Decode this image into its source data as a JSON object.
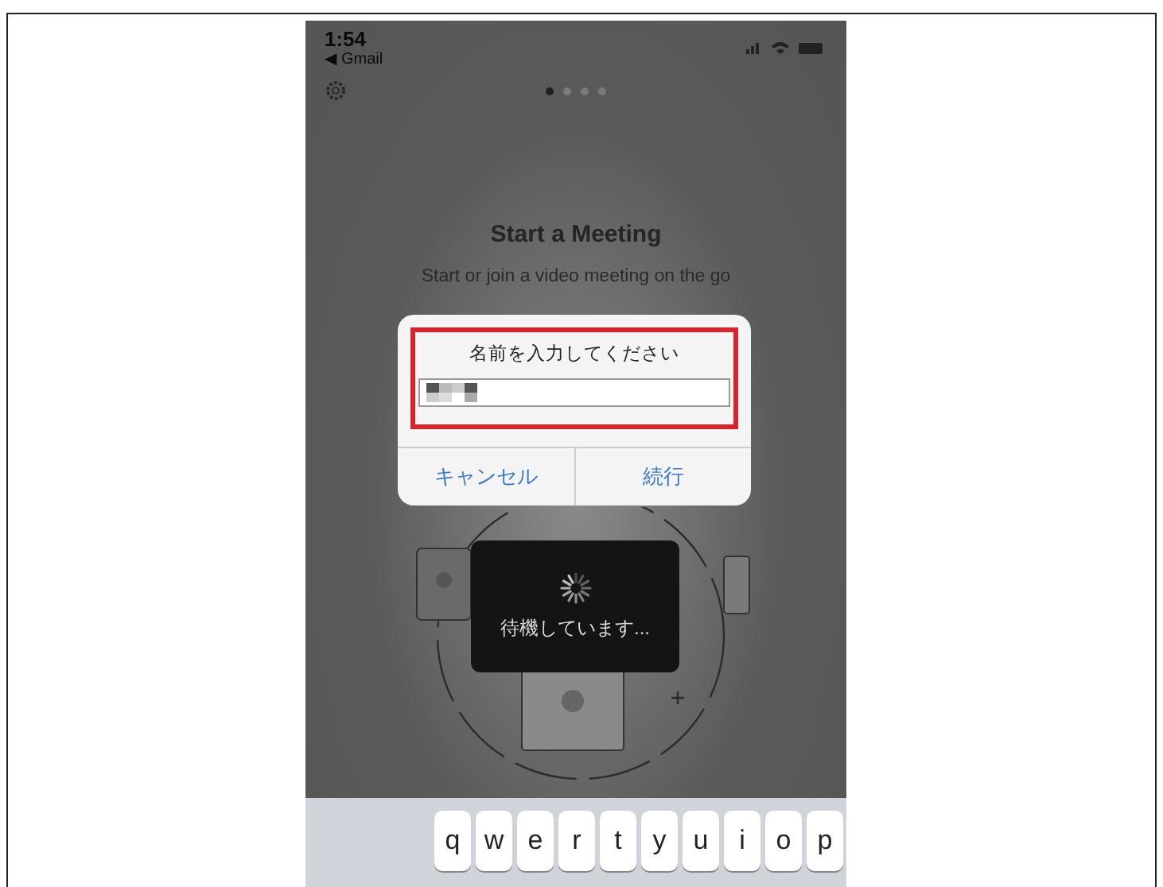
{
  "status_bar": {
    "time": "1:54",
    "back_link": "◀ Gmail"
  },
  "page_indicator": [
    {
      "selected": true
    },
    {
      "selected": false
    },
    {
      "selected": false
    },
    {
      "selected": false
    }
  ],
  "title": "Start a Meeting",
  "subtitle": "Start or join a video meeting on the go",
  "dialog": {
    "title": "名前を入力してください",
    "highlighted": true,
    "buttons": [
      {
        "label": "キャンセル"
      },
      {
        "label": "続行"
      }
    ]
  },
  "loading": {
    "message": "待機しています..."
  },
  "keyboard": {
    "rows": [
      [
        "q",
        "w",
        "e",
        "r",
        "t",
        "y",
        "u",
        "i",
        "o",
        "p"
      ]
    ]
  }
}
